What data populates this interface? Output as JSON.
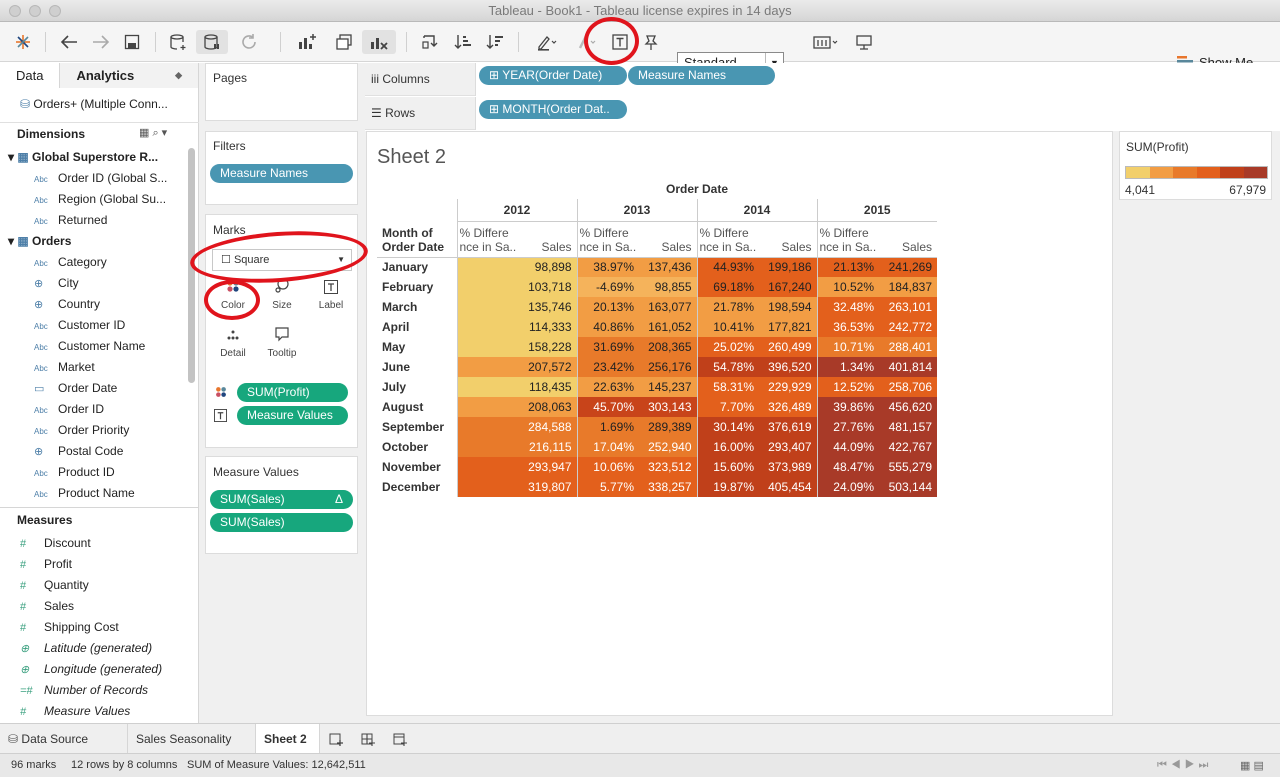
{
  "window": {
    "title": "Tableau - Book1 - Tableau license expires in 14 days"
  },
  "toolbar": {
    "mark_type_view": "Standard",
    "show_me": "Show Me"
  },
  "datapane": {
    "tabs": [
      "Data",
      "Analytics"
    ],
    "connection": "Orders+ (Multiple Conn...",
    "dimensions_title": "Dimensions",
    "groups": [
      {
        "name": "Global Superstore R...",
        "fields": [
          {
            "icon": "Abc",
            "label": "Order ID (Global S..."
          },
          {
            "icon": "Abc",
            "label": "Region (Global Su..."
          },
          {
            "icon": "Abc",
            "label": "Returned"
          }
        ]
      },
      {
        "name": "Orders",
        "fields": [
          {
            "icon": "Abc",
            "label": "Category"
          },
          {
            "icon": "globe",
            "label": "City"
          },
          {
            "icon": "globe",
            "label": "Country"
          },
          {
            "icon": "Abc",
            "label": "Customer ID"
          },
          {
            "icon": "Abc",
            "label": "Customer Name"
          },
          {
            "icon": "Abc",
            "label": "Market"
          },
          {
            "icon": "calendar",
            "label": "Order Date"
          },
          {
            "icon": "Abc",
            "label": "Order ID"
          },
          {
            "icon": "Abc",
            "label": "Order Priority"
          },
          {
            "icon": "globe",
            "label": "Postal Code"
          },
          {
            "icon": "Abc",
            "label": "Product ID"
          },
          {
            "icon": "Abc",
            "label": "Product Name"
          }
        ]
      }
    ],
    "measures_title": "Measures",
    "measures": [
      {
        "icon": "#",
        "label": "Discount"
      },
      {
        "icon": "#",
        "label": "Profit"
      },
      {
        "icon": "#",
        "label": "Quantity"
      },
      {
        "icon": "#",
        "label": "Sales"
      },
      {
        "icon": "#",
        "label": "Shipping Cost"
      },
      {
        "icon": "globe",
        "label": "Latitude (generated)"
      },
      {
        "icon": "globe",
        "label": "Longitude (generated)"
      },
      {
        "icon": "=#",
        "label": "Number of Records"
      },
      {
        "icon": "#",
        "label": "Measure Values"
      }
    ]
  },
  "shelves": {
    "pages": "Pages",
    "filters": "Filters",
    "filter_pill": "Measure Names",
    "marks": "Marks",
    "mark_type": "Square",
    "mark_buttons": [
      "Color",
      "Size",
      "Label",
      "Detail",
      "Tooltip"
    ],
    "mark_pills": [
      "SUM(Profit)",
      "Measure Values"
    ],
    "measure_values": "Measure Values",
    "mv_pills": [
      "SUM(Sales)",
      "SUM(Sales)"
    ],
    "columns_label": "Columns",
    "columns_pills": [
      "YEAR(Order Date)",
      "Measure Names"
    ],
    "rows_label": "Rows",
    "rows_pills": [
      "MONTH(Order Dat.."
    ]
  },
  "sheet": {
    "title": "Sheet 2",
    "column_header": "Order Date",
    "row_header": [
      "Month of",
      "Order Date"
    ],
    "years": [
      "2012",
      "2013",
      "2014",
      "2015"
    ],
    "measure_headers": [
      "% Differe",
      "nce in Sa..",
      "Sales"
    ],
    "months": [
      "January",
      "February",
      "March",
      "April",
      "May",
      "June",
      "July",
      "August",
      "September",
      "October",
      "November",
      "December"
    ],
    "rows": [
      [
        "98,898",
        "38.97%",
        "137,436",
        "44.93%",
        "199,186",
        "21.13%",
        "241,269"
      ],
      [
        "103,718",
        "-4.69%",
        "98,855",
        "69.18%",
        "167,240",
        "10.52%",
        "184,837"
      ],
      [
        "135,746",
        "20.13%",
        "163,077",
        "21.78%",
        "198,594",
        "32.48%",
        "263,101"
      ],
      [
        "114,333",
        "40.86%",
        "161,052",
        "10.41%",
        "177,821",
        "36.53%",
        "242,772"
      ],
      [
        "158,228",
        "31.69%",
        "208,365",
        "25.02%",
        "260,499",
        "10.71%",
        "288,401"
      ],
      [
        "207,572",
        "23.42%",
        "256,176",
        "54.78%",
        "396,520",
        "1.34%",
        "401,814"
      ],
      [
        "118,435",
        "22.63%",
        "145,237",
        "58.31%",
        "229,929",
        "12.52%",
        "258,706"
      ],
      [
        "208,063",
        "45.70%",
        "303,143",
        "7.70%",
        "326,489",
        "39.86%",
        "456,620"
      ],
      [
        "284,588",
        "1.69%",
        "289,389",
        "30.14%",
        "376,619",
        "27.76%",
        "481,157"
      ],
      [
        "216,115",
        "17.04%",
        "252,940",
        "16.00%",
        "293,407",
        "44.09%",
        "422,767"
      ],
      [
        "293,947",
        "10.06%",
        "323,512",
        "15.60%",
        "373,989",
        "48.47%",
        "555,279"
      ],
      [
        "319,807",
        "5.77%",
        "338,257",
        "19.87%",
        "405,454",
        "24.09%",
        "503,144"
      ]
    ],
    "cell_colors": [
      [
        "#f2cf6b",
        "#f29d44",
        "#e3601c",
        "#e3601c"
      ],
      [
        "#f2cf6b",
        "#f5b35b",
        "#e3601c",
        "#f29d44"
      ],
      [
        "#f2cf6b",
        "#f29d44",
        "#f29d44",
        "#e3601c"
      ],
      [
        "#f2cf6b",
        "#f29d44",
        "#f29d44",
        "#e3601c"
      ],
      [
        "#f2cf6b",
        "#e87a2a",
        "#e3601c",
        "#e87a2a"
      ],
      [
        "#f29d44",
        "#e87a2a",
        "#c0401a",
        "#a83a28"
      ],
      [
        "#f2cf6b",
        "#f29d44",
        "#e3601c",
        "#e3601c"
      ],
      [
        "#f29d44",
        "#c8441a",
        "#e3601c",
        "#a83a28"
      ],
      [
        "#e87a2a",
        "#e87a2a",
        "#c0401a",
        "#a83a28"
      ],
      [
        "#e87a2a",
        "#e87a2a",
        "#c0401a",
        "#a83a28"
      ],
      [
        "#e3601c",
        "#e3601c",
        "#c0401a",
        "#a83a28"
      ],
      [
        "#e3601c",
        "#e3601c",
        "#c0401a",
        "#a83a28"
      ]
    ],
    "white_text": [
      [
        false,
        false,
        false,
        false
      ],
      [
        false,
        false,
        false,
        false
      ],
      [
        false,
        false,
        false,
        true
      ],
      [
        false,
        false,
        false,
        true
      ],
      [
        false,
        false,
        true,
        true
      ],
      [
        false,
        false,
        true,
        true
      ],
      [
        false,
        false,
        true,
        true
      ],
      [
        false,
        true,
        true,
        true
      ],
      [
        true,
        false,
        true,
        true
      ],
      [
        true,
        true,
        true,
        true
      ],
      [
        true,
        true,
        true,
        true
      ],
      [
        true,
        true,
        true,
        true
      ]
    ]
  },
  "legend": {
    "title": "SUM(Profit)",
    "min": "4,041",
    "max": "67,979",
    "colors": [
      "#f2cf6b",
      "#f29d44",
      "#e87a2a",
      "#e3601c",
      "#c0401a",
      "#a83a28"
    ]
  },
  "tabs_bottom": [
    "Data Source",
    "Sales Seasonality",
    "Sheet 2"
  ],
  "status": {
    "marks": "96 marks",
    "dims": "12 rows by 8 columns",
    "sum": "SUM of Measure Values: 12,642,511"
  }
}
